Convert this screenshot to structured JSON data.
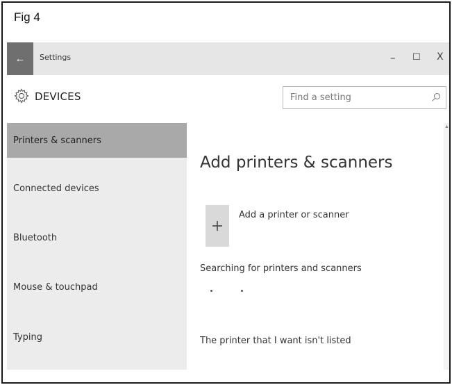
{
  "figure": {
    "label": "Fig 4"
  },
  "window": {
    "title": "Settings",
    "back_glyph": "←",
    "controls": {
      "minimize": "–",
      "maximize": "☐",
      "close": "X"
    }
  },
  "header": {
    "icon": "gear-icon",
    "title": "DEVICES",
    "search": {
      "value": "",
      "placeholder": "Find a setting",
      "icon": "search-icon"
    }
  },
  "sidebar": {
    "items": [
      {
        "label": "Printers & scanners",
        "active": true
      },
      {
        "label": "Connected devices",
        "active": false
      },
      {
        "label": "Bluetooth",
        "active": false
      },
      {
        "label": "Mouse & touchpad",
        "active": false
      },
      {
        "label": "Typing",
        "active": false
      }
    ]
  },
  "content": {
    "title": "Add printers & scanners",
    "add_tile_glyph": "+",
    "add_label": "Add a printer or scanner",
    "status_text": "Searching for printers and scanners",
    "not_listed_link": "The printer that I want isn't listed"
  },
  "colors": {
    "titlebar": "#e6e6e6",
    "back_button": "#6f6f6f",
    "sidebar_bg": "#ececec",
    "sidebar_active": "#a9a9a9",
    "add_tile": "#d9d9d9"
  }
}
